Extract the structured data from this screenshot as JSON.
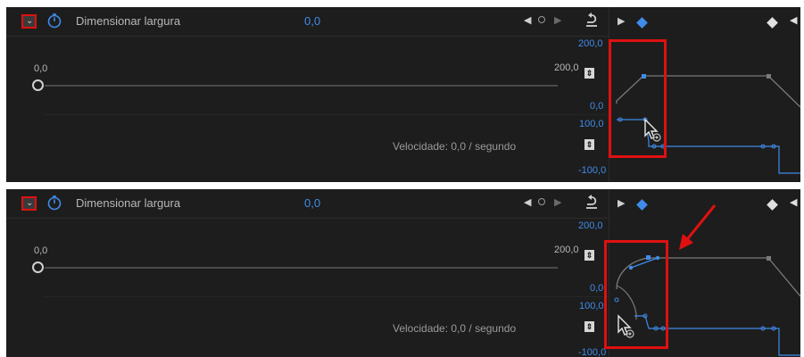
{
  "property": {
    "collapse_glyph": "⌄",
    "name": "Dimensionar largura",
    "value": "0,0"
  },
  "keyframe_nav": {
    "prev_glyph": "◀",
    "next_glyph": "▶",
    "reset_icon": "reset-icon",
    "graph_arrow_glyph": "▶",
    "graph_left_glyph": "◀"
  },
  "slider": {
    "min_label": "0,0",
    "max_label": "200,0"
  },
  "value_graph": {
    "top": "200,0",
    "zero": "0,0",
    "hundred": "100,0",
    "bottom": "-100,0"
  },
  "speed_label": "Velocidade: 0,0 / segundo",
  "updown_glyph": "⇕",
  "colors": {
    "panel_bg": "#1d1d1d",
    "accent_blue": "#3f8bea",
    "highlight_red": "#e01010"
  },
  "panels": [
    "before-linear",
    "after-bezier"
  ]
}
